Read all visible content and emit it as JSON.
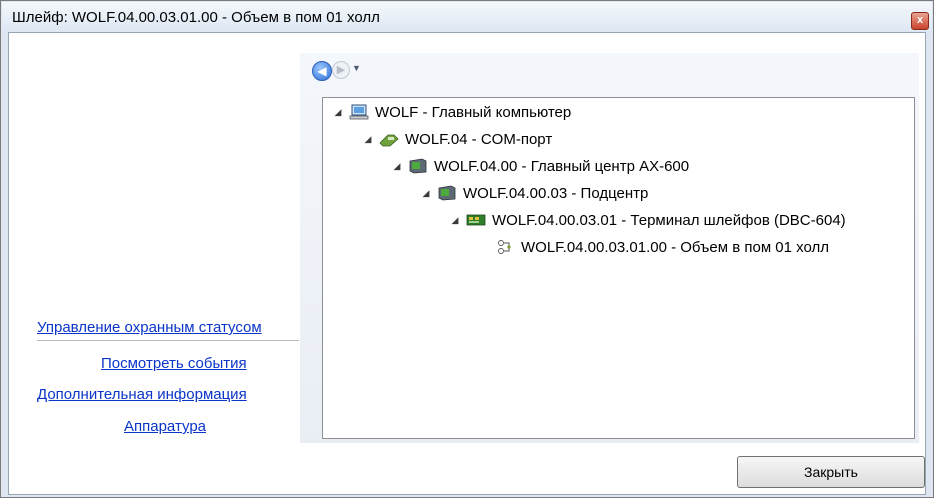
{
  "window": {
    "title": "Шлейф: WOLF.04.00.03.01.00 - Объем в пом 01 холл",
    "close_glyph": "x"
  },
  "left_panel": {
    "links": [
      "Управление охранным статусом",
      "Посмотреть события",
      "Дополнительная информация",
      "Аппаратура"
    ]
  },
  "navigation": {
    "back_glyph": "◀",
    "forward_glyph": "▶",
    "dropdown_glyph": "▼"
  },
  "tree": {
    "nodes": [
      {
        "label": "WOLF - Главный компьютер",
        "icon": "computer-icon",
        "expanded": true
      },
      {
        "label": "WOLF.04 - COM-порт",
        "icon": "com-port-icon",
        "expanded": true
      },
      {
        "label": "WOLF.04.00 - Главный центр AX-600",
        "icon": "controller-icon",
        "expanded": true
      },
      {
        "label": "WOLF.04.00.03 - Подцентр",
        "icon": "subcontroller-icon",
        "expanded": true
      },
      {
        "label": "WOLF.04.00.03.01 - Терминал шлейфов (DBC-604)",
        "icon": "terminal-board-icon",
        "expanded": true
      },
      {
        "label": "WOLF.04.00.03.01.00 - Объем в пом 01 холл",
        "icon": "loop-sensor-icon",
        "expanded": false
      }
    ],
    "expand_glyph": "◢"
  },
  "footer": {
    "close_button_label": "Закрыть"
  },
  "colors": {
    "link": "#0b35c9",
    "title_bar": "#dde7f3",
    "close_red": "#c9432a"
  }
}
